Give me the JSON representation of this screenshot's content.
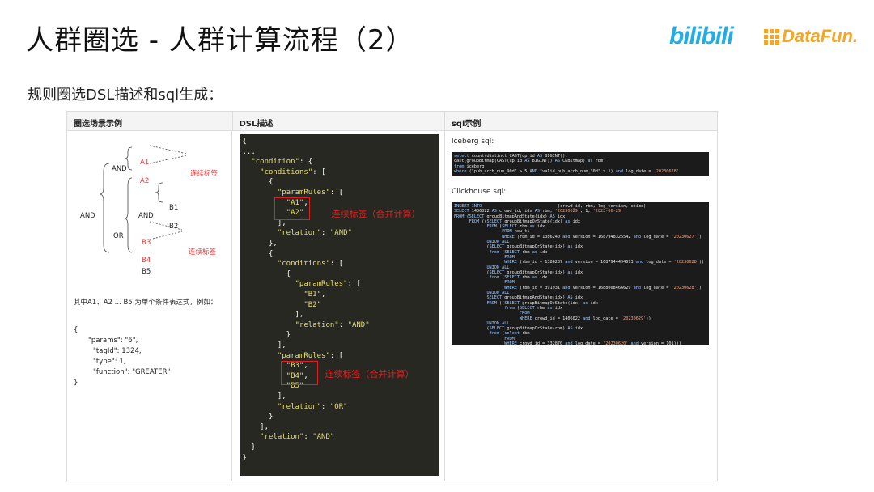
{
  "slide": {
    "title": "人群圈选 - 人群计算流程（2）",
    "subtitle": "规则圈选DSL描述和sql生成：",
    "logo_bilibili": "bilibili",
    "logo_datafun": "DataFun."
  },
  "table": {
    "headers": [
      "圈选场景示例",
      "DSL描述",
      "sql示例"
    ],
    "col1": {
      "tree_labels": {
        "and_root": "AND",
        "and_top": "AND",
        "a1": "A1",
        "a2": "A2",
        "continuous_tag_1": "连续标签",
        "or_node": "OR",
        "and_mid": "AND",
        "b1": "B1",
        "b2": "B2",
        "b3": "B3",
        "b4": "B4",
        "b5": "B5",
        "continuous_tag_2": "连续标签"
      },
      "description": "其中A1、A2 ... B5 为单个条件表达式，例如：",
      "example_lines": [
        "{",
        "\"params\": \"6\",",
        "\"tagId\": 1324,",
        "\"type\": 1,",
        "\"function\": \"GREATER\"",
        "}"
      ]
    },
    "col2": {
      "lines": [
        "{",
        "...",
        "  \"condition\": {",
        "    \"conditions\": [",
        "      {",
        "        \"paramRules\": [",
        "          \"A1\",",
        "          \"A2\"",
        "        ],",
        "        \"relation\": \"AND\"",
        "      },",
        "      {",
        "        \"conditions\": [",
        "          {",
        "            \"paramRules\": [",
        "              \"B1\",",
        "              \"B2\"",
        "            ],",
        "            \"relation\": \"AND\"",
        "          }",
        "        ],",
        "        \"paramRules\": [",
        "          \"B3\",",
        "          \"B4\",",
        "          \"B5\"",
        "        ],",
        "        \"relation\": \"OR\"",
        "      }",
        "    ],",
        "    \"relation\": \"AND\"",
        "  }",
        "}"
      ],
      "note_1": "连续标签（合并计算）",
      "note_2": "连续标签（合并计算）"
    },
    "col3": {
      "iceberg_label": "Iceberg sql:",
      "iceberg_sql": [
        "select count(distinct CAST(up_id AS BIGINT)),",
        "cast(groupBitmap(CAST(up_id AS BIGINT)) AS CKBitmap) as rbm",
        "from iceberg",
        "where (\"pub_arch_num_90d\" > 5 AND \"valid_pub_arch_num_30d\" > 1) and log_date = '20230628'"
      ],
      "clickhouse_label": "Clickhouse sql:",
      "clickhouse_sql": [
        "INSERT INTO                              (crowd_id, rbm, log_version, ctime)",
        "SELECT 1406022 AS crowd_id, idx AS rbm, '20230629', 1, '2023-06-29'",
        "FROM (SELECT groupBitmapAndState(idx) AS idx",
        "      FROM ((SELECT groupBitmapOrState(idx) as idx",
        "             FROM (SELECT rbm as idx",
        "                   FROM new_ti",
        "                   WHERE (rbm_id = 1386240 and version = 1687948325542 and log_date = '20230627'))",
        "             UNION ALL",
        "             (SELECT groupBitmapOrState(idx) as idx",
        "              from (SELECT rbm as idx",
        "                    FROM",
        "                    WHERE (rbm_id = 1386237 and version = 1687944494673 and log_date = '20230628'))",
        "             UNION ALL",
        "             (SELECT groupBitmapOrState(idx) as idx",
        "              from (SELECT rbm as idx",
        "                    FROM",
        "                    WHERE (rbm_id = 391931 and version = 1688008466629 and log_date = '20230628'))",
        "             UNION ALL",
        "             SELECT groupBitmapAndState(idx) AS idx",
        "             FROM ((SELECT groupBitmapOrState(idx) as idx",
        "                    from (SELECT rbm as idx",
        "                          FROM",
        "                          WHERE crowd_id = 1406022 and log_date = '20230629'))",
        "             UNION ALL",
        "             (SELECT groupBitmapOrState(rbm) AS idx",
        "              from (select rbm",
        "                    FROM",
        "                    WHERE crowd_id = 332870 and log_date = '20230620' and version = 101)))"
      ]
    }
  },
  "colors": {
    "red": "#e02020",
    "code_bg": "#272822",
    "code_yellow": "#e6db74",
    "bilibili_blue": "#23ade5",
    "datafun_orange": "#f5a623"
  }
}
